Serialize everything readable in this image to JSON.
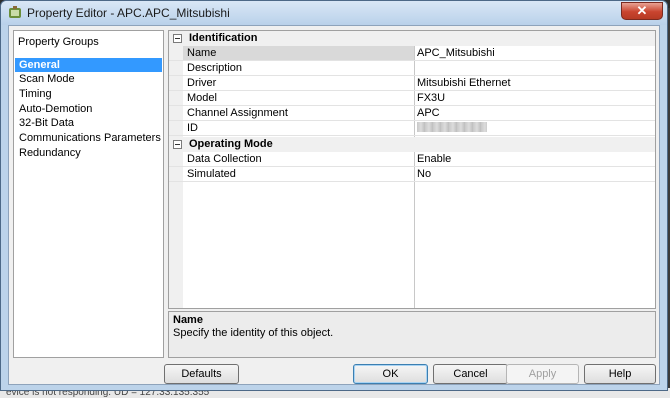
{
  "window": {
    "title": "Property Editor - APC.APC_Mitsubishi",
    "close_glyph": "✕"
  },
  "property_groups": {
    "heading": "Property Groups",
    "items": [
      {
        "label": "General",
        "selected": true
      },
      {
        "label": "Scan Mode"
      },
      {
        "label": "Timing"
      },
      {
        "label": "Auto-Demotion"
      },
      {
        "label": "32-Bit Data"
      },
      {
        "label": "Communications Parameters"
      },
      {
        "label": "Redundancy"
      }
    ]
  },
  "grid": {
    "categories": [
      {
        "label": "Identification"
      },
      {
        "label": "Operating Mode"
      }
    ],
    "identification": [
      {
        "name": "Name",
        "value": "APC_Mitsubishi"
      },
      {
        "name": "Description",
        "value": ""
      },
      {
        "name": "Driver",
        "value": "Mitsubishi Ethernet"
      },
      {
        "name": "Model",
        "value": "FX3U"
      },
      {
        "name": "Channel Assignment",
        "value": "APC"
      },
      {
        "name": "ID",
        "value": ""
      }
    ],
    "operating_mode": [
      {
        "name": "Data Collection",
        "value": "Enable"
      },
      {
        "name": "Simulated",
        "value": "No"
      }
    ]
  },
  "description": {
    "title": "Name",
    "text": "Specify the identity of this object."
  },
  "buttons": {
    "defaults": "Defaults",
    "ok": "OK",
    "cancel": "Cancel",
    "apply": "Apply",
    "help": "Help"
  },
  "status_behind": "evice is not responding. UD = 127.33.135:355'"
}
